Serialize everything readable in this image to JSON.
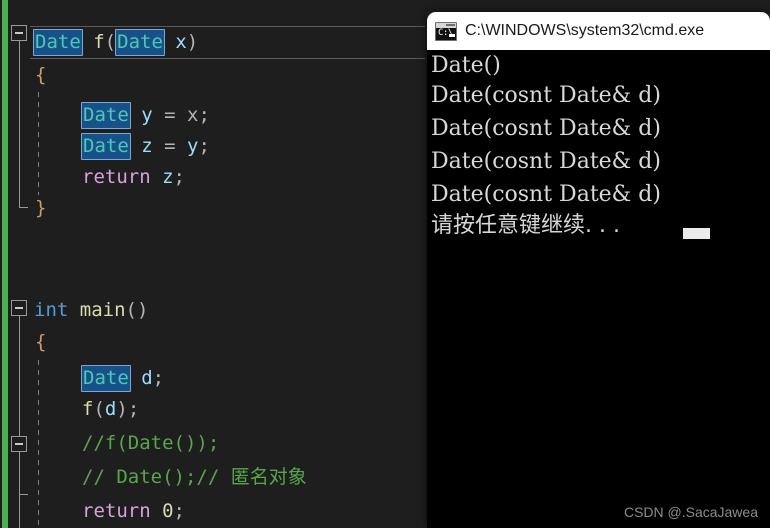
{
  "editor": {
    "background_color": "#1e1e1e",
    "change_bar_color": "#4caf50",
    "highlight_color": "#16518a",
    "code_lines": [
      {
        "indent": 0,
        "text": "Date f(Date x)"
      },
      {
        "indent": 1,
        "text": "{"
      },
      {
        "indent": 2,
        "text": "Date y = x;"
      },
      {
        "indent": 2,
        "text": "Date z = y;"
      },
      {
        "indent": 2,
        "text": "return z;"
      },
      {
        "indent": 1,
        "text": "}"
      },
      {
        "indent": 0,
        "text": "int main()"
      },
      {
        "indent": 1,
        "text": "{"
      },
      {
        "indent": 2,
        "text": "Date d;"
      },
      {
        "indent": 2,
        "text": "f(d);"
      },
      {
        "indent": 2,
        "text": "//f(Date());"
      },
      {
        "indent": 2,
        "text": "// Date();// 匿名对象"
      },
      {
        "indent": 2,
        "text": "return 0;"
      }
    ],
    "tokens": {
      "line1": {
        "type1": "Date",
        "func": "f",
        "paren_open": "(",
        "type2": "Date",
        "param": "x",
        "paren_close": ")"
      },
      "line2": {
        "brace": "{"
      },
      "line3": {
        "type": "Date",
        "var": "y",
        "eq": "=",
        "rhs": "x",
        "semi": ";"
      },
      "line4": {
        "type": "Date",
        "var": "z",
        "eq": "=",
        "rhs": "y",
        "semi": ";"
      },
      "line5": {
        "kw": "return",
        "var": "z",
        "semi": ";"
      },
      "line6": {
        "brace": "}"
      },
      "line7": {
        "kw": "int",
        "func": "main",
        "parens": "()"
      },
      "line8": {
        "brace": "{"
      },
      "line9": {
        "type": "Date",
        "var": "d",
        "semi": ";"
      },
      "line10": {
        "func": "f",
        "paren_open": "(",
        "var": "d",
        "paren_close": ")",
        "semi": ";"
      },
      "line11": {
        "comment": "//f(Date());"
      },
      "line12": {
        "comment": "// Date();// 匿名对象"
      },
      "line13": {
        "kw": "return",
        "num": "0",
        "semi": ";"
      }
    }
  },
  "console": {
    "title": "C:\\WINDOWS\\system32\\cmd.exe",
    "icon": "cmd-icon",
    "icon_prompt": "C:\\",
    "output_lines": [
      "Date()",
      "Date(cosnt Date& d)",
      "Date(cosnt Date& d)",
      "Date(cosnt Date& d)",
      "Date(cosnt Date& d)",
      "请按任意键继续. . ."
    ]
  },
  "watermark": {
    "text": "CSDN @.SacaJawea"
  }
}
